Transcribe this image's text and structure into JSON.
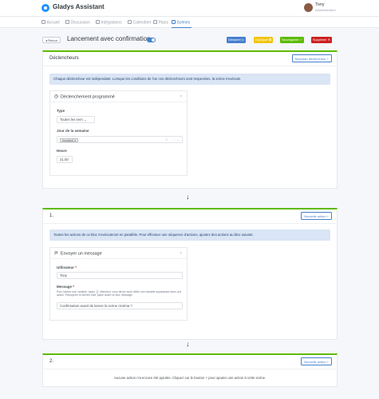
{
  "app": {
    "name": "Gladys Assistant"
  },
  "user": {
    "name": "Tony",
    "role": "Administrateur"
  },
  "nav": [
    {
      "label": "Accueil"
    },
    {
      "label": "Discussion"
    },
    {
      "label": "Intégrations"
    },
    {
      "label": "Calendrier"
    },
    {
      "label": "Plans"
    },
    {
      "label": "Scènes"
    }
  ],
  "header": {
    "back": "◂ Retour",
    "title": "Lancement avec confirmation",
    "enabled": true,
    "buttons": {
      "start": "Démarrer ▷",
      "duplicate": "Dupliquer ⧉",
      "save": "Sauvegarder ✓",
      "delete": "Supprimer ✕"
    }
  },
  "triggers": {
    "title": "Déclencheurs",
    "new_button": "Nouveau déclencheur +",
    "alert": "Chaque déclencheur est indépendant. Lorsque les conditions de l'un ces déclencheurs sont respectées, la scène s'exécute.",
    "block": {
      "title": "Déclenchement programmé",
      "type_label": "Type",
      "type_value": "Toutes les sem ⌄",
      "weekday_label": "Jour de la semaine",
      "weekday_tag": "Vendredi ✕",
      "time_label": "Heure",
      "time_value": "21:00"
    }
  },
  "arrows": {
    "down": "↓"
  },
  "action_group_1": {
    "title": "1.",
    "new_button": "Nouvelle action +",
    "alert": "Toutes les actions de ce bloc s'exécuteront en parallèle. Pour effectuer une séquence d'actions, ajoutez des actions au bloc suivant.",
    "block": {
      "title": "Envoyer un message",
      "user_label": "Utilisateur",
      "user_value": "Tony",
      "message_label": "Message",
      "help": "Pour insérer une variable, tapez '{{'. Attention, vous devez avoir défini une variable auparavant dans une action \"Récupérer le dernier état\" placé avant ce bloc message.",
      "message_value": "Confirmation avant de lancer la scène cinéma ?"
    }
  },
  "action_group_2": {
    "title": "2.",
    "new_button": "Nouvelle action +",
    "empty": "Aucune action n'a encore été ajoutée. Cliquez sur le bouton + pour ajouter une action à cette scène."
  },
  "colors": {
    "primary": "#467fcf",
    "success": "#5eba00",
    "warning": "#f1c40f",
    "danger": "#cd201f",
    "info_bg": "#dae5f5"
  }
}
